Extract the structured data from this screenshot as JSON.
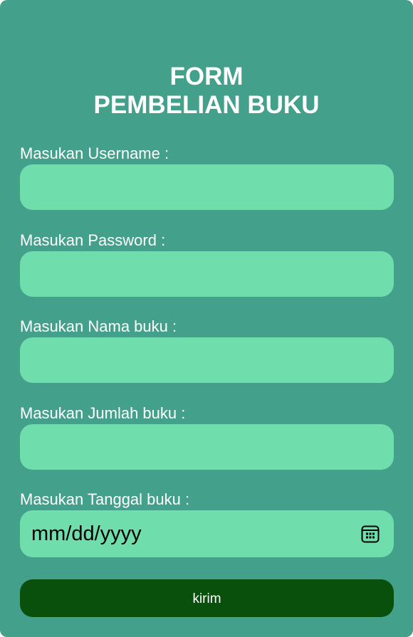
{
  "form": {
    "title_line1": "FORM",
    "title_line2": "PEMBELIAN BUKU",
    "fields": [
      {
        "label": "Masukan Username :",
        "value": "",
        "placeholder": ""
      },
      {
        "label": "Masukan Password :",
        "value": "",
        "placeholder": ""
      },
      {
        "label": "Masukan Nama buku :",
        "value": "",
        "placeholder": ""
      },
      {
        "label": "Masukan Jumlah buku :",
        "value": "",
        "placeholder": ""
      },
      {
        "label": "Masukan Tanggal buku :",
        "value": "mm/dd/yyyy",
        "icon": "calendar-icon"
      }
    ],
    "submit_label": "kirim"
  },
  "colors": {
    "background": "#43a08b",
    "input_fill": "#6fdeac",
    "button_fill": "#08500c",
    "text": "#ffffff"
  }
}
